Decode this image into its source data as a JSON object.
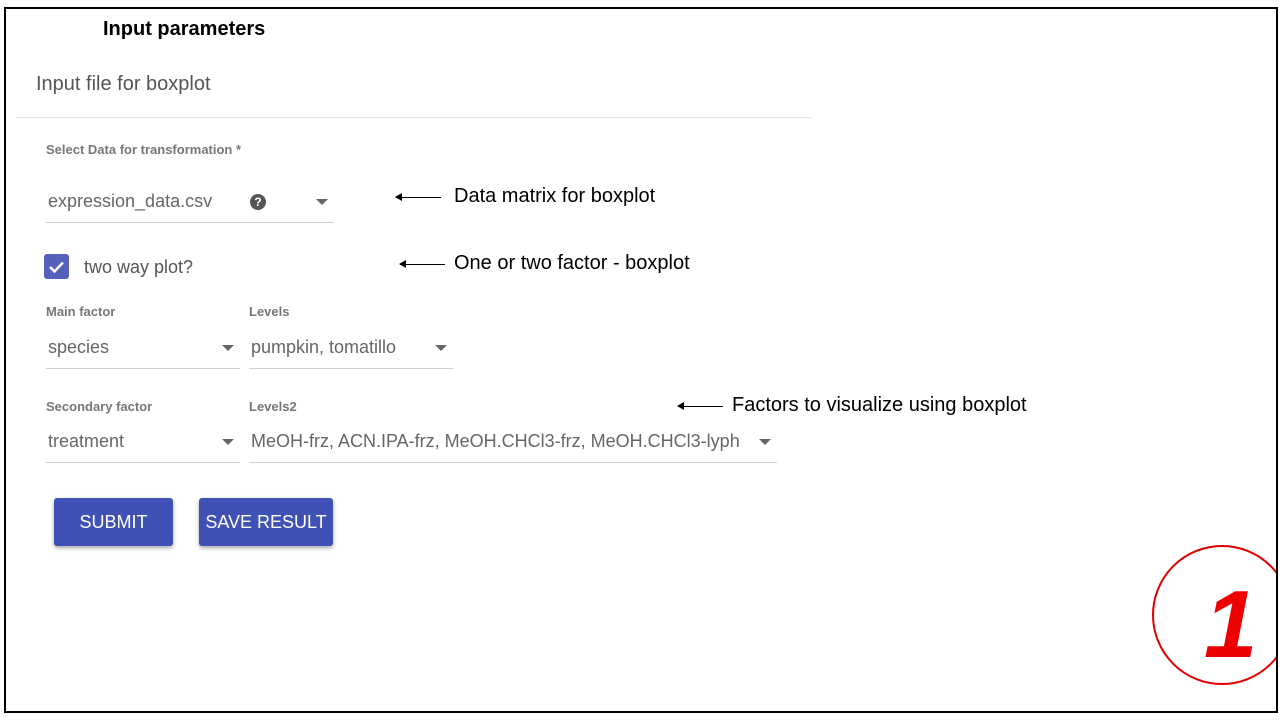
{
  "heading": "Input parameters",
  "card": {
    "title": "Input file for boxplot",
    "data_select": {
      "label": "Select Data for transformation *",
      "value": "expression_data.csv",
      "help_icon": "question-circle-icon"
    },
    "two_way": {
      "label": "two way plot?",
      "checked": true
    },
    "main_factor": {
      "label": "Main factor",
      "value": "species"
    },
    "levels": {
      "label": "Levels",
      "value": "pumpkin, tomatillo"
    },
    "secondary_factor": {
      "label": "Secondary factor",
      "value": "treatment"
    },
    "levels2": {
      "label": "Levels2",
      "value": "MeOH-frz, ACN.IPA-frz, MeOH.CHCl3-frz, MeOH.CHCl3-lyph"
    },
    "buttons": {
      "submit": "SUBMIT",
      "save": "SAVE RESULT"
    }
  },
  "annotations": {
    "data_matrix": "Data matrix for boxplot",
    "factor_count": "One or two factor - boxplot",
    "factors": "Factors to visualize using boxplot"
  },
  "step_number": "1",
  "colors": {
    "primary": "#3f51b5",
    "checkbox": "#5561b8",
    "step": "#ee0000"
  }
}
